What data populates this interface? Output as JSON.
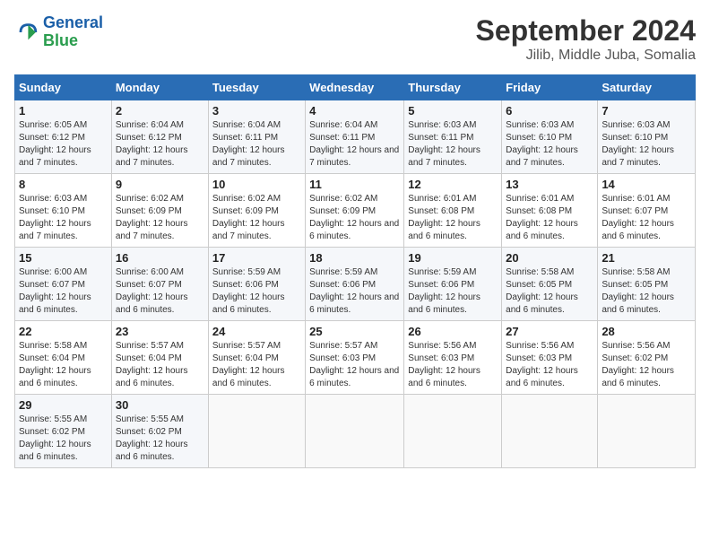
{
  "header": {
    "logo_line1": "General",
    "logo_line2": "Blue",
    "month": "September 2024",
    "location": "Jilib, Middle Juba, Somalia"
  },
  "weekdays": [
    "Sunday",
    "Monday",
    "Tuesday",
    "Wednesday",
    "Thursday",
    "Friday",
    "Saturday"
  ],
  "weeks": [
    [
      {
        "day": "1",
        "rise": "6:05 AM",
        "set": "6:12 PM",
        "daylight": "12 hours and 7 minutes."
      },
      {
        "day": "2",
        "rise": "6:04 AM",
        "set": "6:12 PM",
        "daylight": "12 hours and 7 minutes."
      },
      {
        "day": "3",
        "rise": "6:04 AM",
        "set": "6:11 PM",
        "daylight": "12 hours and 7 minutes."
      },
      {
        "day": "4",
        "rise": "6:04 AM",
        "set": "6:11 PM",
        "daylight": "12 hours and 7 minutes."
      },
      {
        "day": "5",
        "rise": "6:03 AM",
        "set": "6:11 PM",
        "daylight": "12 hours and 7 minutes."
      },
      {
        "day": "6",
        "rise": "6:03 AM",
        "set": "6:10 PM",
        "daylight": "12 hours and 7 minutes."
      },
      {
        "day": "7",
        "rise": "6:03 AM",
        "set": "6:10 PM",
        "daylight": "12 hours and 7 minutes."
      }
    ],
    [
      {
        "day": "8",
        "rise": "6:03 AM",
        "set": "6:10 PM",
        "daylight": "12 hours and 7 minutes."
      },
      {
        "day": "9",
        "rise": "6:02 AM",
        "set": "6:09 PM",
        "daylight": "12 hours and 7 minutes."
      },
      {
        "day": "10",
        "rise": "6:02 AM",
        "set": "6:09 PM",
        "daylight": "12 hours and 7 minutes."
      },
      {
        "day": "11",
        "rise": "6:02 AM",
        "set": "6:09 PM",
        "daylight": "12 hours and 6 minutes."
      },
      {
        "day": "12",
        "rise": "6:01 AM",
        "set": "6:08 PM",
        "daylight": "12 hours and 6 minutes."
      },
      {
        "day": "13",
        "rise": "6:01 AM",
        "set": "6:08 PM",
        "daylight": "12 hours and 6 minutes."
      },
      {
        "day": "14",
        "rise": "6:01 AM",
        "set": "6:07 PM",
        "daylight": "12 hours and 6 minutes."
      }
    ],
    [
      {
        "day": "15",
        "rise": "6:00 AM",
        "set": "6:07 PM",
        "daylight": "12 hours and 6 minutes."
      },
      {
        "day": "16",
        "rise": "6:00 AM",
        "set": "6:07 PM",
        "daylight": "12 hours and 6 minutes."
      },
      {
        "day": "17",
        "rise": "5:59 AM",
        "set": "6:06 PM",
        "daylight": "12 hours and 6 minutes."
      },
      {
        "day": "18",
        "rise": "5:59 AM",
        "set": "6:06 PM",
        "daylight": "12 hours and 6 minutes."
      },
      {
        "day": "19",
        "rise": "5:59 AM",
        "set": "6:06 PM",
        "daylight": "12 hours and 6 minutes."
      },
      {
        "day": "20",
        "rise": "5:58 AM",
        "set": "6:05 PM",
        "daylight": "12 hours and 6 minutes."
      },
      {
        "day": "21",
        "rise": "5:58 AM",
        "set": "6:05 PM",
        "daylight": "12 hours and 6 minutes."
      }
    ],
    [
      {
        "day": "22",
        "rise": "5:58 AM",
        "set": "6:04 PM",
        "daylight": "12 hours and 6 minutes."
      },
      {
        "day": "23",
        "rise": "5:57 AM",
        "set": "6:04 PM",
        "daylight": "12 hours and 6 minutes."
      },
      {
        "day": "24",
        "rise": "5:57 AM",
        "set": "6:04 PM",
        "daylight": "12 hours and 6 minutes."
      },
      {
        "day": "25",
        "rise": "5:57 AM",
        "set": "6:03 PM",
        "daylight": "12 hours and 6 minutes."
      },
      {
        "day": "26",
        "rise": "5:56 AM",
        "set": "6:03 PM",
        "daylight": "12 hours and 6 minutes."
      },
      {
        "day": "27",
        "rise": "5:56 AM",
        "set": "6:03 PM",
        "daylight": "12 hours and 6 minutes."
      },
      {
        "day": "28",
        "rise": "5:56 AM",
        "set": "6:02 PM",
        "daylight": "12 hours and 6 minutes."
      }
    ],
    [
      {
        "day": "29",
        "rise": "5:55 AM",
        "set": "6:02 PM",
        "daylight": "12 hours and 6 minutes."
      },
      {
        "day": "30",
        "rise": "5:55 AM",
        "set": "6:02 PM",
        "daylight": "12 hours and 6 minutes."
      },
      null,
      null,
      null,
      null,
      null
    ]
  ]
}
